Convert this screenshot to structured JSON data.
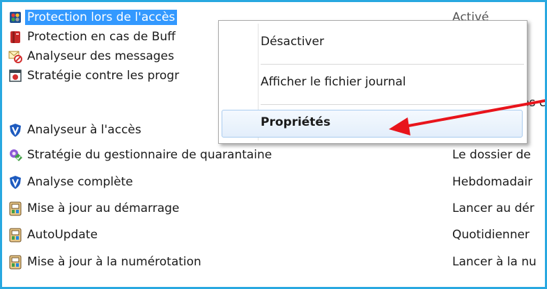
{
  "rows": [
    {
      "label": "Protection lors de l'accès",
      "icon": "traffic-light-icon",
      "value": "Activé"
    },
    {
      "label": "Protection en cas de Buff",
      "icon": "red-shield-book-icon",
      "value": ""
    },
    {
      "label": "Analyseur des messages",
      "icon": "mail-forbidden-icon",
      "value": ""
    },
    {
      "label": "Stratégie contre les progr",
      "icon": "window-red-icon",
      "value": "es c"
    },
    {
      "label": "Analyseur à l'accès",
      "icon": "shield-v-icon",
      "value": ""
    },
    {
      "label": "Stratégie du gestionnaire de quarantaine",
      "icon": "quarantine-icon",
      "value": "Le dossier de"
    },
    {
      "label": "Analyse complète",
      "icon": "shield-v-icon",
      "value": "Hebdomadair"
    },
    {
      "label": "Mise à jour au démarrage",
      "icon": "update-icon",
      "value": "Lancer au dér"
    },
    {
      "label": "AutoUpdate",
      "icon": "update-icon",
      "value": "Quotidienner"
    },
    {
      "label": "Mise à jour à la numérotation",
      "icon": "update-icon",
      "value": "Lancer à la nu"
    }
  ],
  "context_menu": {
    "items": [
      "Désactiver",
      "Afficher le fichier journal",
      "Propriétés"
    ],
    "highlighted": "Propriétés"
  },
  "colors": {
    "frame": "#28a8e0",
    "selection": "#3399ff",
    "arrow": "#e8141b"
  }
}
